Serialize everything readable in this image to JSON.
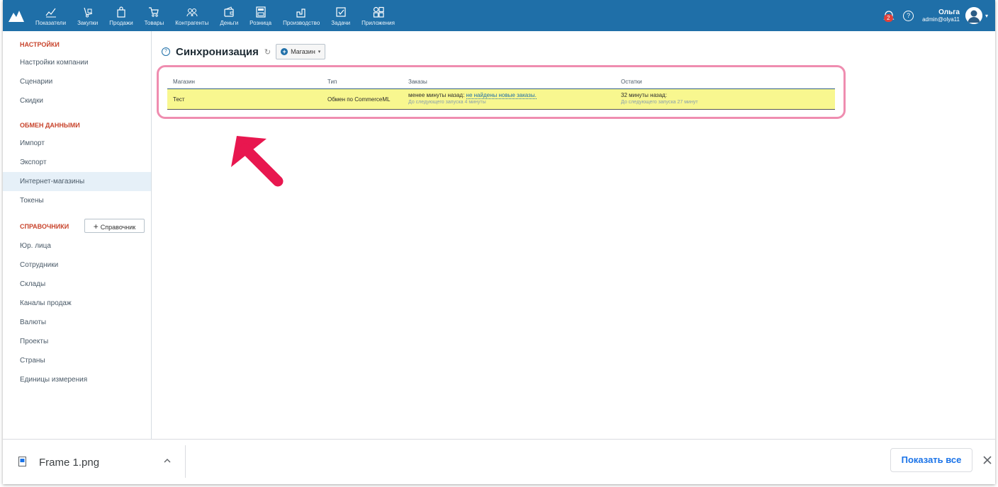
{
  "nav": {
    "items": [
      {
        "label": "Показатели",
        "icon": "chart-icon"
      },
      {
        "label": "Закупки",
        "icon": "dolly-icon"
      },
      {
        "label": "Продажи",
        "icon": "bag-icon"
      },
      {
        "label": "Товары",
        "icon": "cart-icon"
      },
      {
        "label": "Контрагенты",
        "icon": "people-icon"
      },
      {
        "label": "Деньги",
        "icon": "wallet-icon"
      },
      {
        "label": "Розница",
        "icon": "register-icon"
      },
      {
        "label": "Производство",
        "icon": "factory-icon"
      },
      {
        "label": "Задачи",
        "icon": "checkbox-icon"
      },
      {
        "label": "Приложения",
        "icon": "apps-icon"
      }
    ],
    "notifications_count": "2",
    "help": "?",
    "user_name": "Ольга",
    "user_login": "admin@olya11"
  },
  "sidebar": {
    "section_settings": "НАСТРОЙКИ",
    "settings_items": [
      "Настройки компании",
      "Сценарии",
      "Скидки"
    ],
    "section_exchange": "ОБМЕН ДАННЫМИ",
    "exchange_items": [
      "Импорт",
      "Экспорт",
      "Интернет-магазины",
      "Токены"
    ],
    "section_refs": "СПРАВОЧНИКИ",
    "add_ref_label": "Справочник",
    "ref_items": [
      "Юр. лица",
      "Сотрудники",
      "Склады",
      "Каналы продаж",
      "Валюты",
      "Проекты",
      "Страны",
      "Единицы измерения"
    ]
  },
  "main": {
    "title": "Синхронизация",
    "shop_button": "Магазин",
    "table": {
      "headers": [
        "Магазин",
        "Тип",
        "Заказы",
        "Остатки"
      ],
      "row": {
        "shop": "Тест",
        "type": "Обмен по CommerceML",
        "orders_time": "менее минуты назад:",
        "orders_status": "не найдены новые заказы.",
        "orders_next": "До следующего запуска 4 минуты",
        "stock_time": "32 минуты назад:",
        "stock_next": "До следующего запуска 27 минут"
      }
    }
  },
  "download_bar": {
    "file_name": "Frame 1.png",
    "show_all": "Показать все"
  },
  "colors": {
    "navbar": "#1f6fa8",
    "section_label": "#c8442c",
    "highlight_border": "#ef8db0",
    "row_highlight": "#f8f78f",
    "arrow": "#e8174f"
  }
}
